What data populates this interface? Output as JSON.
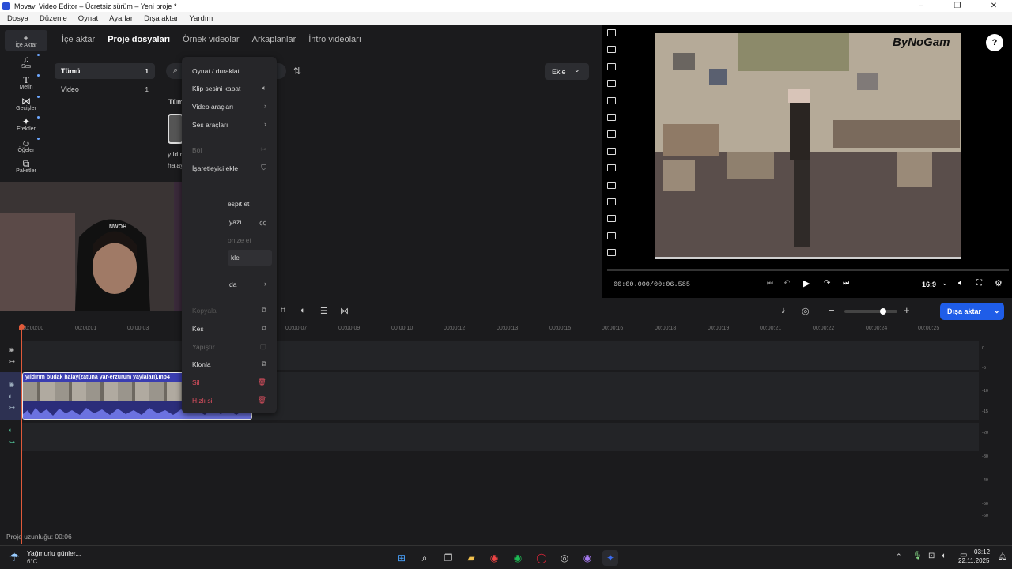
{
  "window": {
    "title": "Movavi Video Editor – Ücretsiz sürüm – Yeni proje *"
  },
  "menu": [
    "Dosya",
    "Düzenle",
    "Oynat",
    "Ayarlar",
    "Dışa aktar",
    "Yardım"
  ],
  "sidebar": [
    {
      "label": "İçe Aktar",
      "icon": "plus-icon"
    },
    {
      "label": "Ses",
      "icon": "music-icon"
    },
    {
      "label": "Metin",
      "icon": "text-icon"
    },
    {
      "label": "Geçişler",
      "icon": "transition-icon"
    },
    {
      "label": "Efektler",
      "icon": "sparkle-icon"
    },
    {
      "label": "Öğeler",
      "icon": "smiley-icon"
    },
    {
      "label": "Paketler",
      "icon": "package-icon"
    }
  ],
  "tabs": [
    "İçe aktar",
    "Proje dosyaları",
    "Örnek videolar",
    "Arkaplanlar",
    "İntro videoları"
  ],
  "filters": [
    {
      "label": "Tümü",
      "count": "1"
    },
    {
      "label": "Video",
      "count": "1"
    }
  ],
  "media": {
    "header": "Tüm",
    "item_label_1": "yıldır",
    "item_label_2": "halay"
  },
  "add_button": "Ekle",
  "context_menu": {
    "play_pause": "Oynat / duraklat",
    "mute": "Klip sesini kapat",
    "video_tools": "Video araçları",
    "audio_tools": "Ses araçları",
    "split": "Böl",
    "add_marker": "İşaretleyici ekle",
    "detect_partial": "espit et",
    "subtitles_partial": "yazı",
    "sync_partial": "onize et",
    "add_partial": "kle",
    "more_partial": "da",
    "copy_partial": "Kopyala",
    "cut": "Kes",
    "paste": "Yapıştır",
    "clone": "Klonla",
    "delete": "Sil",
    "ripple_delete": "Hızlı sil"
  },
  "preview": {
    "timecode": "00:00.000/00:06.585",
    "aspect": "16:9",
    "watermark": "ByNoGam"
  },
  "webcam": {
    "label": "logi",
    "cap_text": "NWOH"
  },
  "export_button": "Dışa aktar",
  "ruler": [
    "00:00:00",
    "00:00:01",
    "00:00:03",
    "00:00:07",
    "00:00:09",
    "00:00:10",
    "00:00:12",
    "00:00:13",
    "00:00:15",
    "00:00:16",
    "00:00:18",
    "00:00:19",
    "00:00:21",
    "00:00:22",
    "00:00:24",
    "00:00:25"
  ],
  "clip": {
    "name": "yıldırım budak halay(zatuna yar-erzurum yaylaları).mp4"
  },
  "vu_scale": [
    "0",
    "-5",
    "-10",
    "-15",
    "-20",
    "-30",
    "-40",
    "-50",
    "-60"
  ],
  "status": "Proje uzunluğu: 00:06",
  "taskbar": {
    "weather_title": "Yağmurlu günler...",
    "weather_temp": "6°C",
    "time": "03:12",
    "date": "22.11.2025"
  },
  "colors": {
    "accent": "#1f5de8",
    "playhead": "#e05a3a",
    "clip": "#2b2d7a",
    "danger": "#e05060"
  }
}
